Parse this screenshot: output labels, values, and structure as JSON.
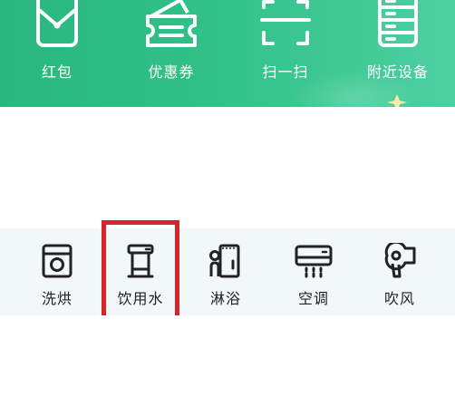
{
  "top_actions": [
    {
      "label": "红包",
      "icon": "red-envelope-icon"
    },
    {
      "label": "优惠券",
      "icon": "coupon-ticket-icon"
    },
    {
      "label": "扫一扫",
      "icon": "scan-icon"
    },
    {
      "label": "附近设备",
      "icon": "nearby-device-icon"
    }
  ],
  "categories": [
    {
      "label": "洗烘",
      "icon": "washer-dryer-icon"
    },
    {
      "label": "饮用水",
      "icon": "water-dispenser-icon"
    },
    {
      "label": "淋浴",
      "icon": "shower-icon"
    },
    {
      "label": "空调",
      "icon": "air-conditioner-icon"
    },
    {
      "label": "吹风",
      "icon": "hair-dryer-icon"
    }
  ],
  "colors": {
    "banner_green": "#30c088",
    "highlight_red": "#d9232a",
    "strip_background": "#f2f7fa"
  }
}
